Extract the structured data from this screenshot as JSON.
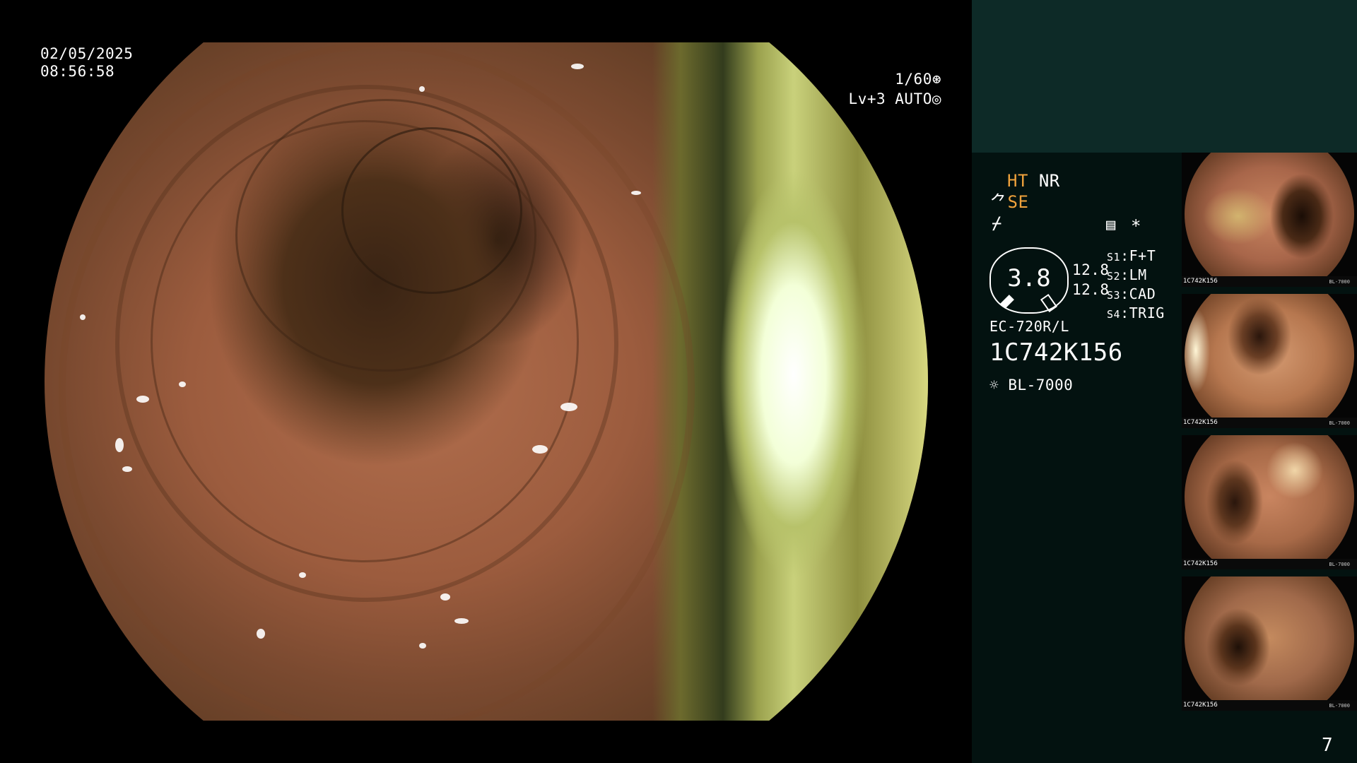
{
  "header": {
    "date": "02/05/2025",
    "time": "08:56:58"
  },
  "camera": {
    "shutter": "1/60",
    "shutter_icon": "aperture-icon",
    "level": "Lv+3 AUTO",
    "level_icon": "iris-icon"
  },
  "modes": {
    "ht": "HT",
    "nr": "NR",
    "se": "SE"
  },
  "scope_info": {
    "zoom_value": "3.8",
    "val_a": "12.8",
    "val_b": "12.8",
    "model": "EC-720R/L",
    "serial": "1C742K156",
    "light": "BL-7000"
  },
  "switches": [
    {
      "key": "S1",
      "value": "F+T"
    },
    {
      "key": "S2",
      "value": "LM"
    },
    {
      "key": "S3",
      "value": "CAD"
    },
    {
      "key": "S4",
      "value": "TRIG"
    }
  ],
  "asterisk": "*",
  "thumbnails": [
    {
      "id": "1C742K156",
      "light": "BL-7000"
    },
    {
      "id": "1C742K156",
      "light": "BL-7000"
    },
    {
      "id": "1C742K156",
      "light": "BL-7000"
    },
    {
      "id": "1C742K156",
      "light": "BL-7000"
    }
  ],
  "page_number": "7",
  "colors": {
    "accent_orange": "#f0a23c",
    "panel_bg": "#031210",
    "panel_top": "#0d2a27"
  }
}
